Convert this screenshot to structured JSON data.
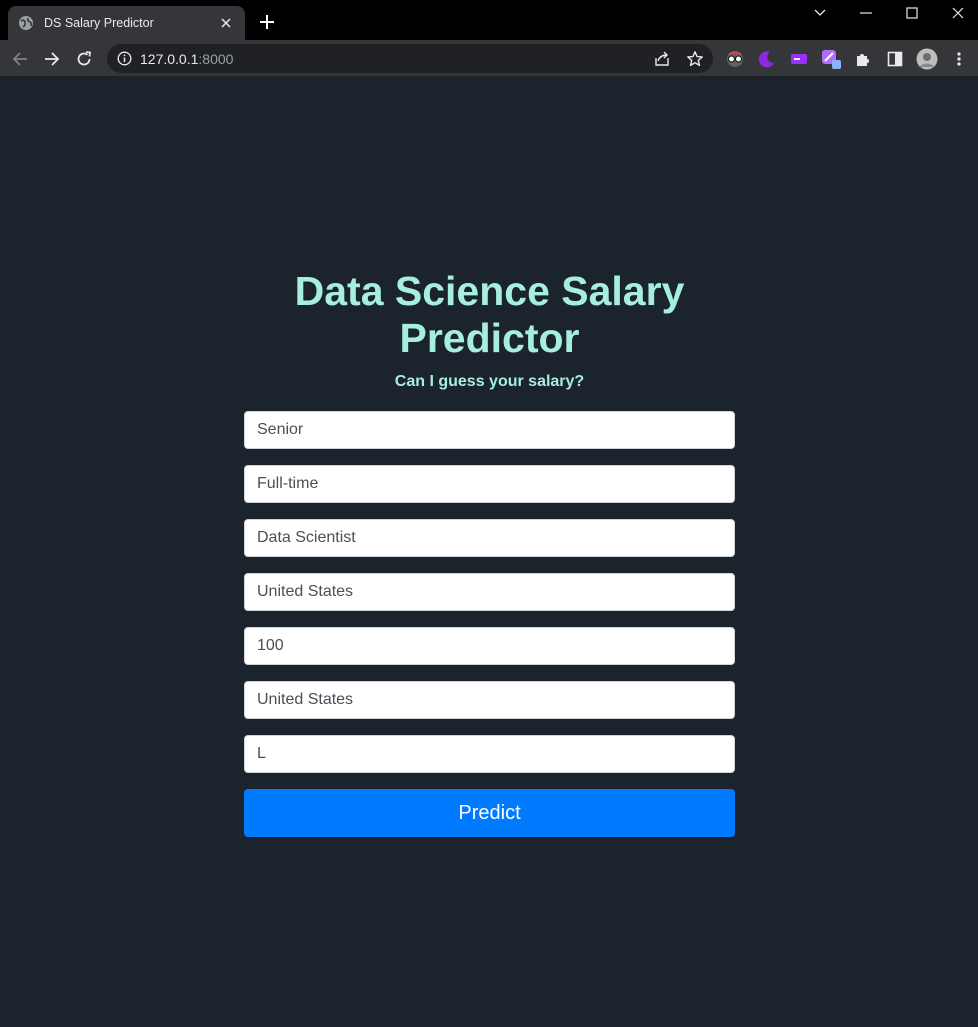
{
  "browser": {
    "tab_title": "DS Salary Predictor",
    "url_host": "127.0.0.1",
    "url_port": ":8000"
  },
  "page": {
    "title": "Data Science Salary Predictor",
    "subtitle": "Can I guess your salary?",
    "fields": [
      {
        "name": "experience-level-input",
        "value": "Senior"
      },
      {
        "name": "employment-type-input",
        "value": "Full-time"
      },
      {
        "name": "job-title-input",
        "value": "Data Scientist"
      },
      {
        "name": "employee-residence-input",
        "value": "United States"
      },
      {
        "name": "remote-ratio-input",
        "value": "100"
      },
      {
        "name": "company-location-input",
        "value": "United States"
      },
      {
        "name": "company-size-input",
        "value": "L"
      }
    ],
    "predict_label": "Predict"
  },
  "colors": {
    "page_bg": "#1b232c",
    "accent_text": "#a6eedd",
    "button": "#007bff"
  }
}
